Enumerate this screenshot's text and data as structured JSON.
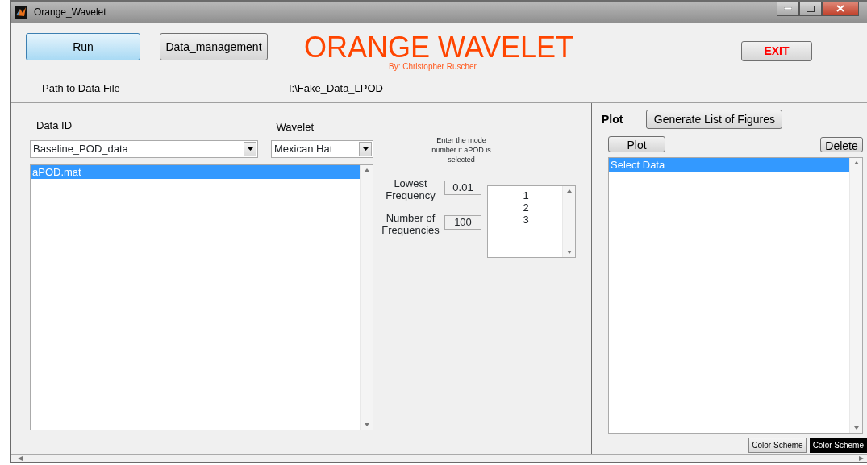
{
  "window": {
    "title": "Orange_Wavelet"
  },
  "header": {
    "run_button": "Run",
    "data_button": "Data_management",
    "title": "ORANGE WAVELET",
    "subtitle": "By: Christopher Ruscher",
    "exit_button": "EXIT",
    "path_label": "Path to Data File",
    "path_value": "I:\\Fake_Data_LPOD"
  },
  "left_panel": {
    "data_id_label": "Data ID",
    "data_id_dropdown": "Baseline_POD_data",
    "wavelet_label": "Wavelet",
    "wavelet_dropdown": "Mexican Hat",
    "files": [
      {
        "label": "aPOD.mat",
        "selected": true
      }
    ],
    "mode_hint": "Enter the mode number if aPOD is selected",
    "fields": [
      {
        "label": "Lowest Frequency",
        "value": "0.01"
      },
      {
        "label": "Number of Frequencies",
        "value": "100"
      }
    ],
    "modes": [
      {
        "label": "1",
        "selected": false
      },
      {
        "label": "2",
        "selected": false
      },
      {
        "label": "3",
        "selected": false
      }
    ]
  },
  "right_panel": {
    "title": "Plot",
    "generate_button": "Generate List of Figures",
    "plot_button": "Plot",
    "delete_button": "Delete",
    "figures": [
      {
        "label": "Select Data",
        "selected": true
      }
    ],
    "scheme_buttons": [
      {
        "label": "Color Scheme",
        "kind": "light"
      },
      {
        "label": "Color Scheme",
        "kind": "dark"
      }
    ]
  }
}
